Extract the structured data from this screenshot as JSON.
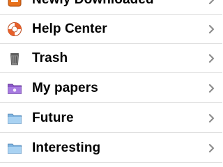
{
  "list": {
    "items": [
      {
        "label": "Newly Downloaded",
        "icon": "download-badge-icon"
      },
      {
        "label": "Help Center",
        "icon": "lifebuoy-icon"
      },
      {
        "label": "Trash",
        "icon": "trash-can-icon"
      },
      {
        "label": "My papers",
        "icon": "purple-folder-icon"
      },
      {
        "label": "Future",
        "icon": "folder-icon"
      },
      {
        "label": "Interesting",
        "icon": "folder-icon"
      }
    ]
  },
  "colors": {
    "row_border": "#e0e0e0",
    "chevron": "#8e8e8e",
    "folder_blue": "#8ec1ea",
    "folder_purple": "#8b57c9",
    "download_orange": "#e8701a",
    "lifebuoy_orange": "#e8602a"
  }
}
